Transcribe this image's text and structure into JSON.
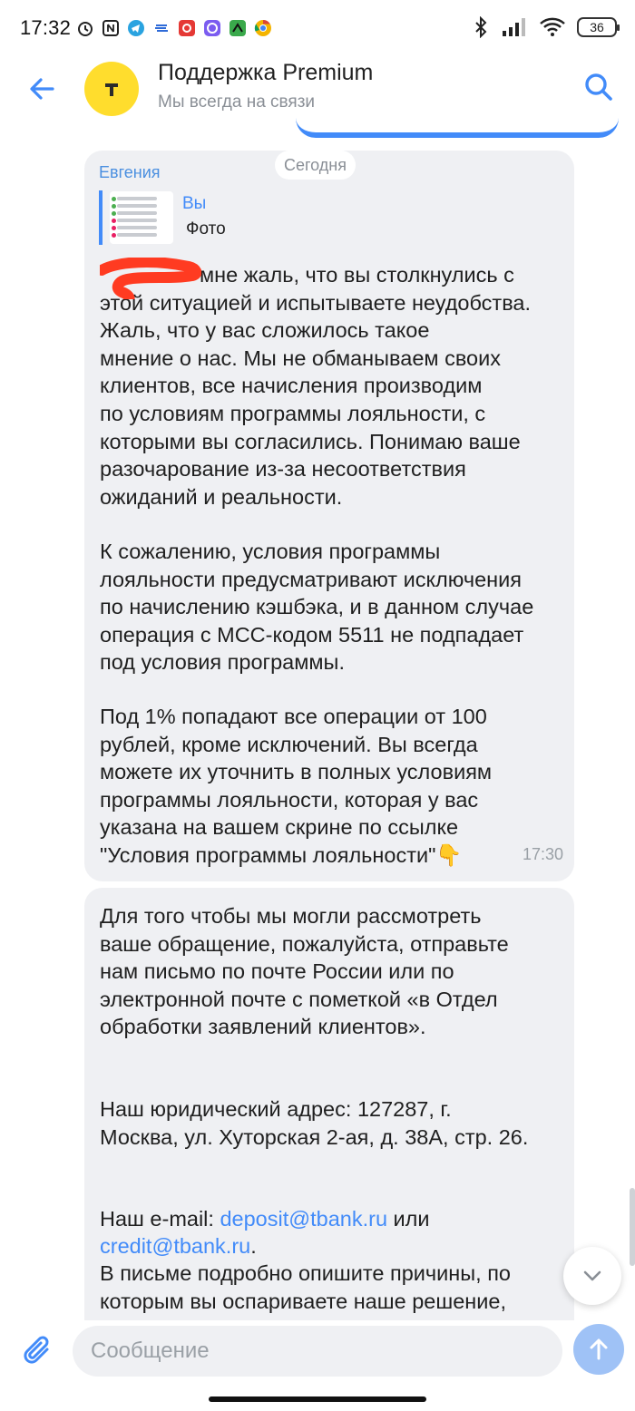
{
  "status_bar": {
    "time": "17:32",
    "battery": "36",
    "network_badge": "6"
  },
  "header": {
    "title": "Поддержка Premium",
    "subtitle": "Мы всегда на связи",
    "avatar_letter": "T",
    "brand_color": "#ffdd2d",
    "accent_color": "#428bf9"
  },
  "date_separator": "Сегодня",
  "message1": {
    "sender": "Евгения",
    "reply": {
      "name": "Вы",
      "text": "Фото"
    },
    "paragraph1": "мне жаль, что вы столкнулись с\nэтой ситуацией и испытываете неудобства.\nЖаль, что у вас сложилось такое\nмнение о нас. Мы не обманываем своих\nклиентов, все начисления производим\nпо условиям программы лояльности, с\nкоторыми вы согласились. Понимаю ваше\nразочарование из-за несоответствия\nожиданий и реальности.",
    "paragraph2": "К сожалению, условия программы\nлояльности предусматривают исключения\nпо начислению кэшбэка, и в данном случае\nоперация с МСС-кодом 5511 не подпадает\nпод условия программы.",
    "paragraph3": "Под 1% попадают все операции от 100\nрублей, кроме исключений. Вы всегда\nможете их уточнить в полных условиям\nпрограммы лояльности, которая у вас\nуказана на вашем скрине по ссылке\n\"Условия программы лояльности\"👇",
    "time": "17:30"
  },
  "message2": {
    "paragraph1": "Для того чтобы мы могли рассмотреть\nваше обращение, пожалуйста, отправьте\nнам письмо по почте России или по\nэлектронной почте с пометкой «в Отдел\nобработки заявлений клиентов».",
    "paragraph2": "Наш юридический адрес: 127287, г.\nМосква, ул. Хуторская 2-ая, д. 38А, стр. 26.",
    "email_prefix": "Наш e-mail: ",
    "email1": "deposit@tbank.ru",
    "email_or": " или",
    "email2": "credit@tbank.ru",
    "email_end": ".",
    "paragraph4": "В письме подробно опишите причины, по\nкоторым вы оспариваете наше решение,"
  },
  "input": {
    "placeholder": "Сообщение"
  },
  "icons": {
    "back": "arrow-left-icon",
    "search": "search-icon",
    "attach": "paperclip-icon",
    "send": "arrow-up-icon",
    "scroll_down": "chevron-down-icon"
  }
}
